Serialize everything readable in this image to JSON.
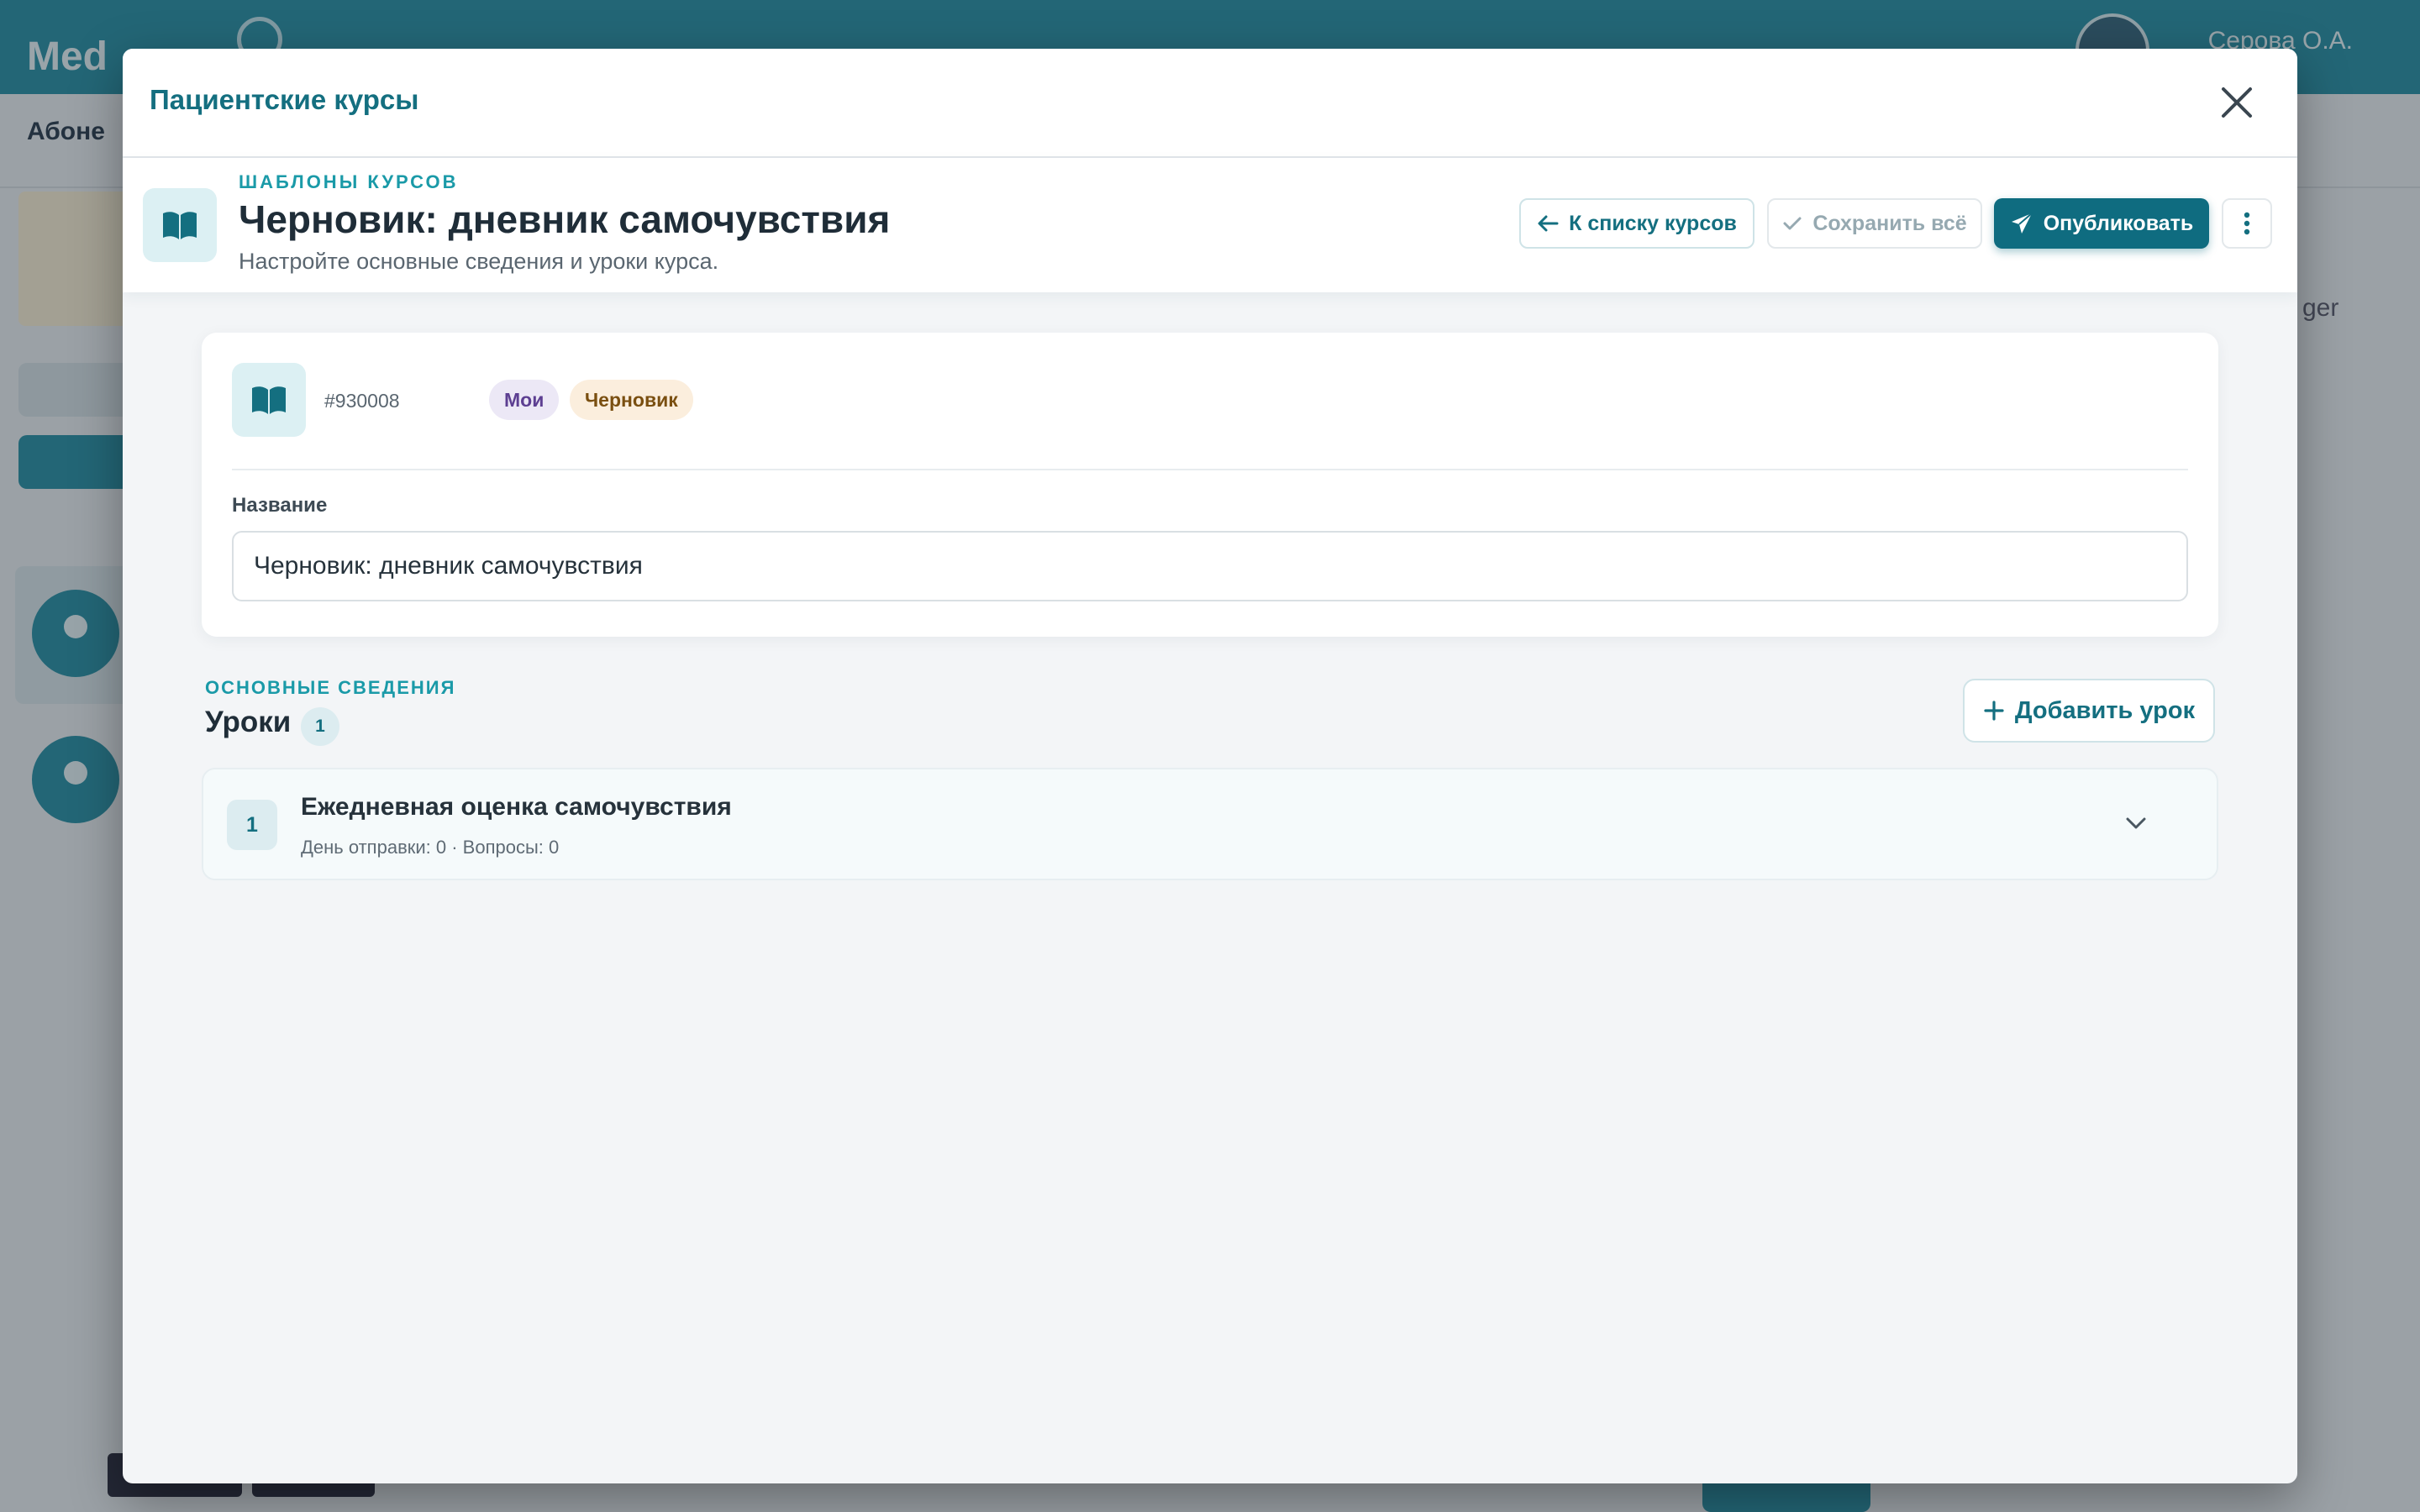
{
  "background": {
    "logo": "Med",
    "user": "Серова О.А.",
    "subnav": "Абоне",
    "right_hint": "ger"
  },
  "modal": {
    "title": "Пациентские курсы"
  },
  "header": {
    "kicker": "ШАБЛОНЫ КУРСОВ",
    "title": "Черновик: дневник самочувствия",
    "subtitle": "Настройте основные сведения и уроки курса.",
    "back_label": "К списку курсов",
    "save_label": "Сохранить всё",
    "publish_label": "Опубликовать"
  },
  "course": {
    "id": "#930008",
    "badges": {
      "mine": "Мои",
      "draft": "Черновик"
    },
    "name_label": "Название",
    "name_value": "Черновик: дневник самочувствия"
  },
  "lessons_section": {
    "kicker": "ОСНОВНЫЕ СВЕДЕНИЯ",
    "title": "Уроки",
    "count": "1",
    "add_label": "Добавить урок",
    "items": [
      {
        "number": "1",
        "title": "Ежедневная оценка самочувствия",
        "meta": "День отправки: 0 · Вопросы: 0"
      }
    ]
  },
  "colors": {
    "accent": "#146f80",
    "primary_button": "#0f6c80",
    "kicker": "#1a9aa8"
  }
}
